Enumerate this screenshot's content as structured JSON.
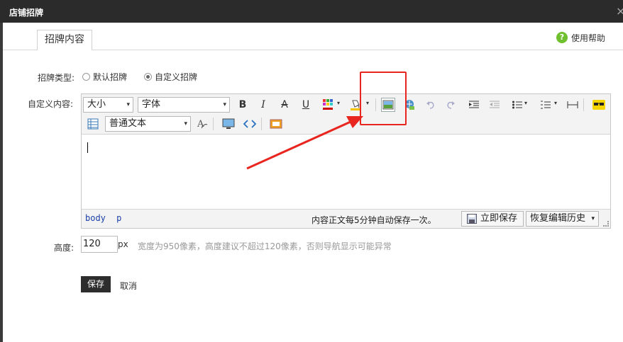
{
  "dialog": {
    "title": "店铺招牌",
    "close_glyph": "×"
  },
  "tabs": [
    {
      "label": "招牌内容"
    }
  ],
  "help": {
    "label": "使用帮助",
    "icon": "?"
  },
  "form": {
    "type_label": "招牌类型:",
    "type_options": [
      {
        "label": "默认招牌",
        "checked": false
      },
      {
        "label": "自定义招牌",
        "checked": true
      }
    ],
    "content_label": "自定义内容:",
    "height_label": "高度:",
    "height_value": "120",
    "height_unit": "px",
    "height_hint": "宽度为950像素，高度建议不超过120像素，否则导航显示可能异常",
    "save_label": "保存",
    "cancel_label": "取消"
  },
  "editor": {
    "size_select": "大小",
    "font_select": "字体",
    "format_select": "普通文本",
    "bold": "B",
    "italic": "I",
    "strike": "A",
    "underline": "U",
    "path": [
      "body",
      "p"
    ],
    "autosave_text": "内容正文每5分钟自动保存一次。",
    "save_now_label": "立即保存",
    "restore_label": "恢复编辑历史",
    "dropdown_glyph": "▾"
  },
  "colors": {
    "highlight": "#e8261f",
    "title_bar": "#2b2b2b",
    "help_green": "#6fbf2e",
    "path_blue": "#1a3fa8"
  }
}
